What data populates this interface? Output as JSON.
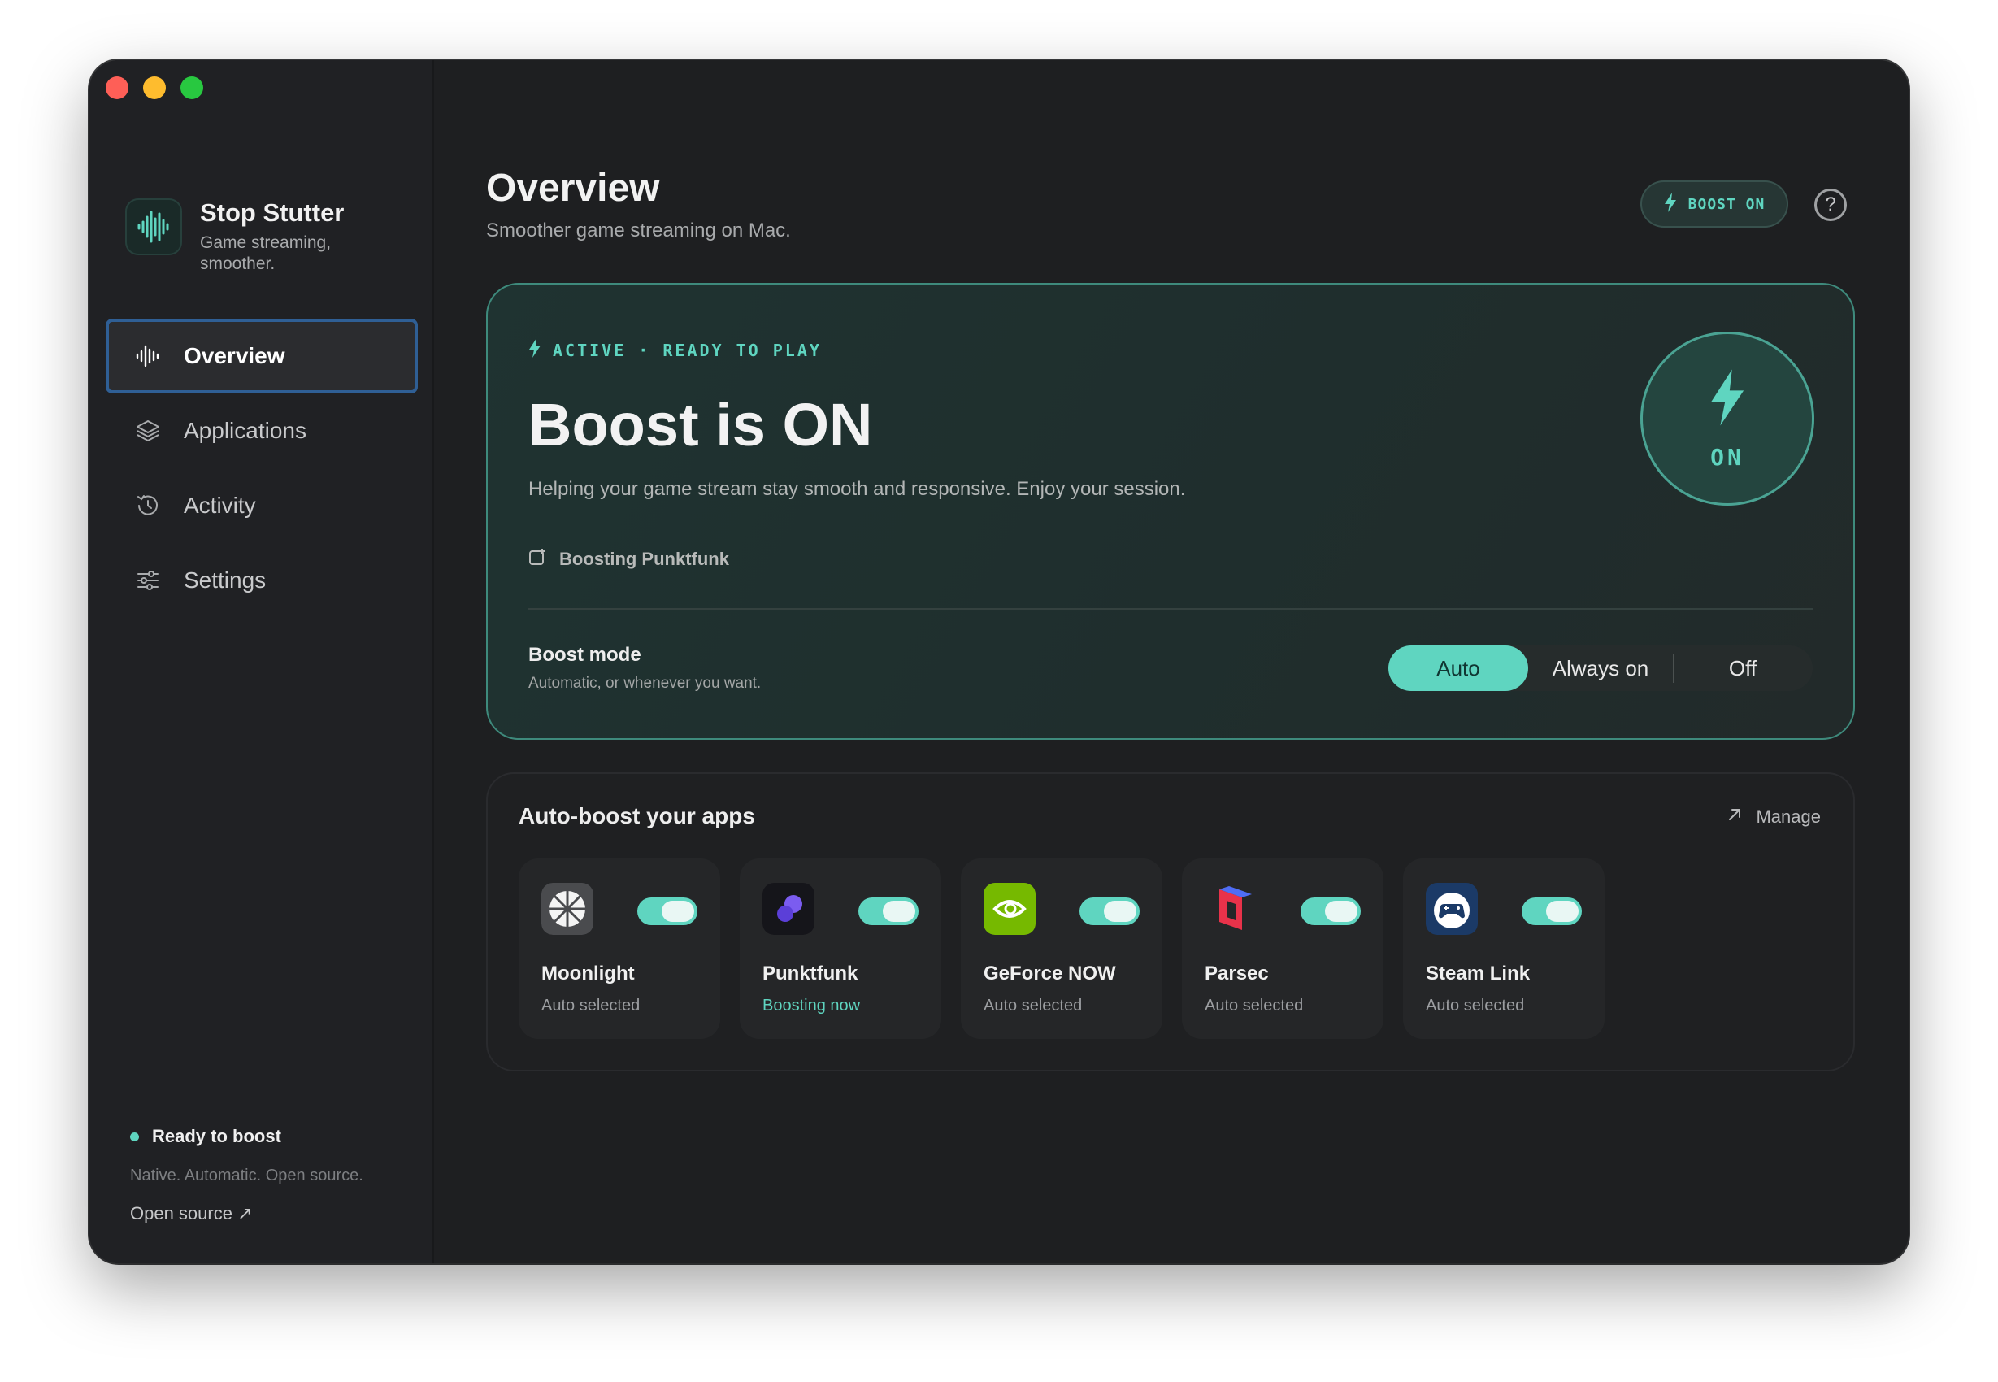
{
  "app": {
    "name": "Stop Stutter",
    "tagline": "Game streaming, smoother.",
    "accent_color": "#5fd5c0"
  },
  "sidebar": {
    "items": [
      {
        "label": "Overview",
        "icon": "waveform-icon",
        "active": true
      },
      {
        "label": "Applications",
        "icon": "layers-icon",
        "active": false
      },
      {
        "label": "Activity",
        "icon": "history-clock-icon",
        "active": false
      },
      {
        "label": "Settings",
        "icon": "sliders-icon",
        "active": false
      }
    ],
    "footer": {
      "status": "Ready to boost",
      "note": "Native. Automatic. Open source.",
      "link": "Open source ↗"
    }
  },
  "header": {
    "title": "Overview",
    "subtitle": "Smoother game streaming on Mac.",
    "boost_pill": "BOOST ON",
    "help_label": "?"
  },
  "hero": {
    "kicker": "ACTIVE · READY TO PLAY",
    "title": "Boost is ON",
    "description": "Helping your game stream stay smooth and responsive. Enjoy your session.",
    "boosting_app": "Boosting Punktfunk",
    "badge_text": "ON",
    "mode": {
      "label": "Boost mode",
      "sublabel": "Automatic, or whenever you want.",
      "options": [
        "Auto",
        "Always on",
        "Off"
      ],
      "selected": "Auto"
    }
  },
  "apps_section": {
    "title": "Auto-boost your apps",
    "manage_label": "Manage",
    "apps": [
      {
        "name": "Moonlight",
        "status": "Auto selected",
        "enabled": true
      },
      {
        "name": "Punktfunk",
        "status": "Boosting now",
        "enabled": true
      },
      {
        "name": "GeForce NOW",
        "status": "Auto selected",
        "enabled": true
      },
      {
        "name": "Parsec",
        "status": "Auto selected",
        "enabled": true
      },
      {
        "name": "Steam Link",
        "status": "Auto selected",
        "enabled": true
      }
    ]
  }
}
